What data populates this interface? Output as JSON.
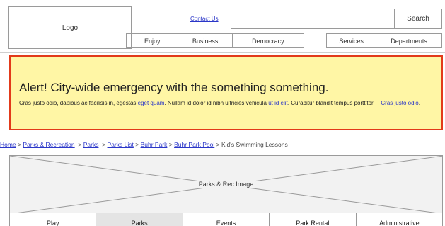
{
  "header": {
    "logo_label": "Logo",
    "contact_link": "Contact Us",
    "search_value": "",
    "search_button": "Search"
  },
  "nav": {
    "primary": [
      "Enjoy",
      "Business",
      "Democracy"
    ],
    "secondary": [
      "Services",
      "Departments"
    ]
  },
  "alert": {
    "title": "Alert!  City-wide emergency with the something something.",
    "body_1": "Cras justo odio, dapibus ac facilisis in, egestas ",
    "link_1": "eget quam",
    "body_2": ". Nullam id dolor id nibh ultricies vehicula ",
    "link_2": "ut id elit",
    "body_3": ". Curabitur blandit tempus porttitor.    ",
    "link_3": "Cras justo odio",
    "body_4": ".",
    "colors": {
      "background": "#fff6a5",
      "border": "#e23a1a"
    }
  },
  "breadcrumb": {
    "items": [
      "Home",
      "Parks & Recreation",
      "Parks",
      "Parks List",
      "Buhr Park",
      "Buhr Park Pool"
    ],
    "current": "Kid's Swimming Lessons",
    "separator": ">"
  },
  "hero": {
    "label": "Parks & Rec Image"
  },
  "tabs": {
    "items": [
      "Play",
      "Parks",
      "Events",
      "Park Rental",
      "Administrative"
    ],
    "active_index": 1
  },
  "colors": {
    "link": "#2a36c8",
    "border": "#9a9a9a"
  }
}
